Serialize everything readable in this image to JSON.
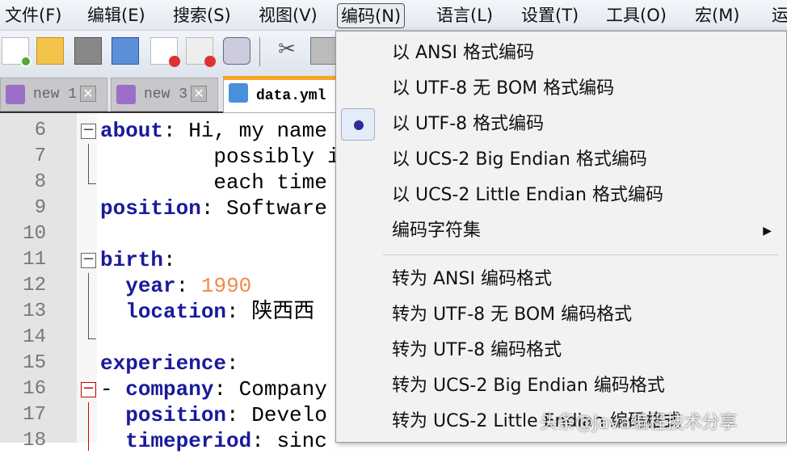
{
  "menubar": {
    "items": [
      "文件(F)",
      "编辑(E)",
      "搜索(S)",
      "视图(V)",
      "编码(N)",
      "语言(L)",
      "设置(T)",
      "工具(O)",
      "宏(M)",
      "运"
    ],
    "active": "编码(N)"
  },
  "toolbar": {
    "icons": [
      "new-file-icon",
      "open-file-icon",
      "save-icon",
      "save-all-icon",
      "close-icon",
      "close-all-icon",
      "print-icon",
      "cut-icon",
      "copy-icon"
    ]
  },
  "tabs": [
    {
      "label": "new 1",
      "close": "✕"
    },
    {
      "label": "new 3",
      "close": "✕"
    },
    {
      "label": "data.yml"
    }
  ],
  "editor": {
    "lines": [
      {
        "n": "6",
        "key": "about",
        "rest": ": Hi, my name"
      },
      {
        "n": "7",
        "text": "         possibly im"
      },
      {
        "n": "8",
        "text": "         each time I"
      },
      {
        "n": "9",
        "key": "position",
        "rest": ": Software",
        "indent": ""
      },
      {
        "n": "10"
      },
      {
        "n": "11",
        "key": "birth",
        "rest": ":"
      },
      {
        "n": "12",
        "key": "year",
        "rest": ": ",
        "num": "1990",
        "indent": "  "
      },
      {
        "n": "13",
        "key": "location",
        "rest": ": 陕西西",
        "indent": "  "
      },
      {
        "n": "14"
      },
      {
        "n": "15",
        "key": "experience",
        "rest": ":"
      },
      {
        "n": "16",
        "pre": "- ",
        "key": "company",
        "rest": ": Company"
      },
      {
        "n": "17",
        "key": "position",
        "rest": ": Develo",
        "indent": "  "
      },
      {
        "n": "18",
        "key": "timeperiod",
        "rest": ": sinc",
        "indent": "  "
      }
    ]
  },
  "encoding_menu": {
    "items": [
      "以 ANSI 格式编码",
      "以 UTF-8 无 BOM 格式编码",
      "以 UTF-8 格式编码",
      "以 UCS-2 Big Endian 格式编码",
      "以 UCS-2 Little Endian 格式编码",
      "编码字符集"
    ],
    "convert_items": [
      "转为 ANSI 编码格式",
      "转为 UTF-8 无 BOM 编码格式",
      "转为 UTF-8 编码格式",
      "转为 UCS-2 Big Endian 编码格式",
      "转为 UCS-2 Little Endian 编码格式"
    ],
    "selected": "以 UTF-8 格式编码",
    "submenu_arrow": "▶"
  },
  "watermark": "头条@Java编程技术分享"
}
